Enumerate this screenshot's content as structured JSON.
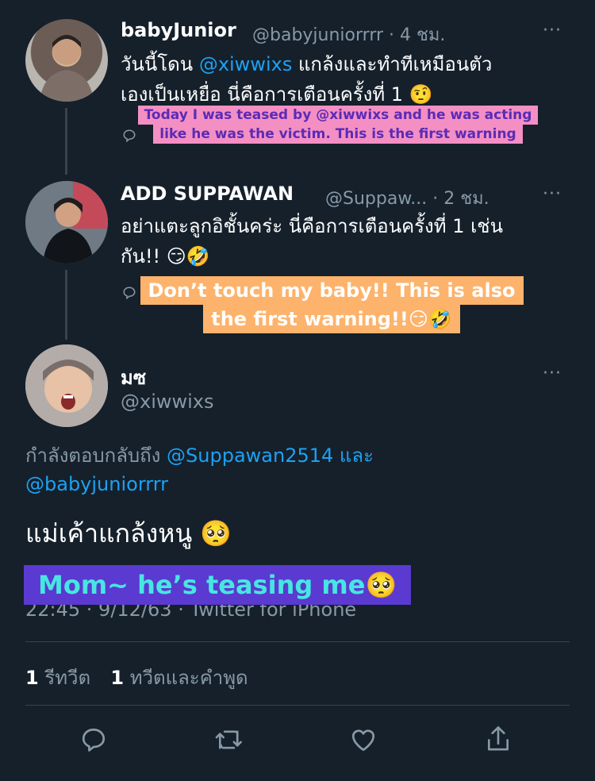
{
  "colors": {
    "background": "#15202b",
    "text": "#ffffff",
    "muted": "#8899a6",
    "link": "#1da1f2",
    "divider": "#38444d",
    "caption1_bg": "#f48fc4",
    "caption1_text": "#5b2bb5",
    "caption2_bg": "#fdb36b",
    "caption2_text": "#ffffff",
    "caption3_bg": "#5a3ad1",
    "caption3_text": "#47e6e1"
  },
  "tweet1": {
    "name": "babyJunior",
    "meta": "@babyjuniorrrr · 4 ชม.",
    "line1_pre": "วันนี้โดน ",
    "line1_mention": "@xiwwixs",
    "line1_post": " แกล้งและทำทีเหมือนตัว",
    "line2": "เองเป็นเหยื่อ นี่คือการเตือนครั้งที่ 1 🤨",
    "caption_line1": "Today I was teased by @xiwwixs and he was acting",
    "caption_line2": "like he was the victim. This is the first warning"
  },
  "tweet2": {
    "name": "ADD  SUPPAWAN",
    "meta": "@Suppaw... · 2 ชม.",
    "line1": "อย่าแตะลูกอิชั้นคร่ะ  นี่คือการเตือนครั้งที่ 1 เช่น",
    "line2": "กัน!! 😏🤣",
    "caption_line1": "Don’t touch my baby!! This is also",
    "caption_line2": "the first warning!!😏🤣"
  },
  "tweet3": {
    "name": "มซ",
    "handle": "@xiwwixs",
    "reply_pre": "กำลังตอบกลับถึง ",
    "reply_mention1": "@Suppawan2514",
    "reply_and": " และ",
    "reply_mention2": "@babyjuniorrrr",
    "text": "แม่เค้าแกล้งหนู 🥺",
    "caption": "Mom~ he’s teasing me🥺",
    "timestamp": "22:45 · 9/12/63 · Twitter for iPhone"
  },
  "stats": {
    "retweets_count": "1",
    "retweets_label": "รีทวีต",
    "quotes_count": "1",
    "quotes_label": "ทวีตและคำพูด"
  },
  "more_icon": "···",
  "icons": [
    "reply-icon",
    "retweet-icon",
    "like-icon",
    "share-icon"
  ]
}
